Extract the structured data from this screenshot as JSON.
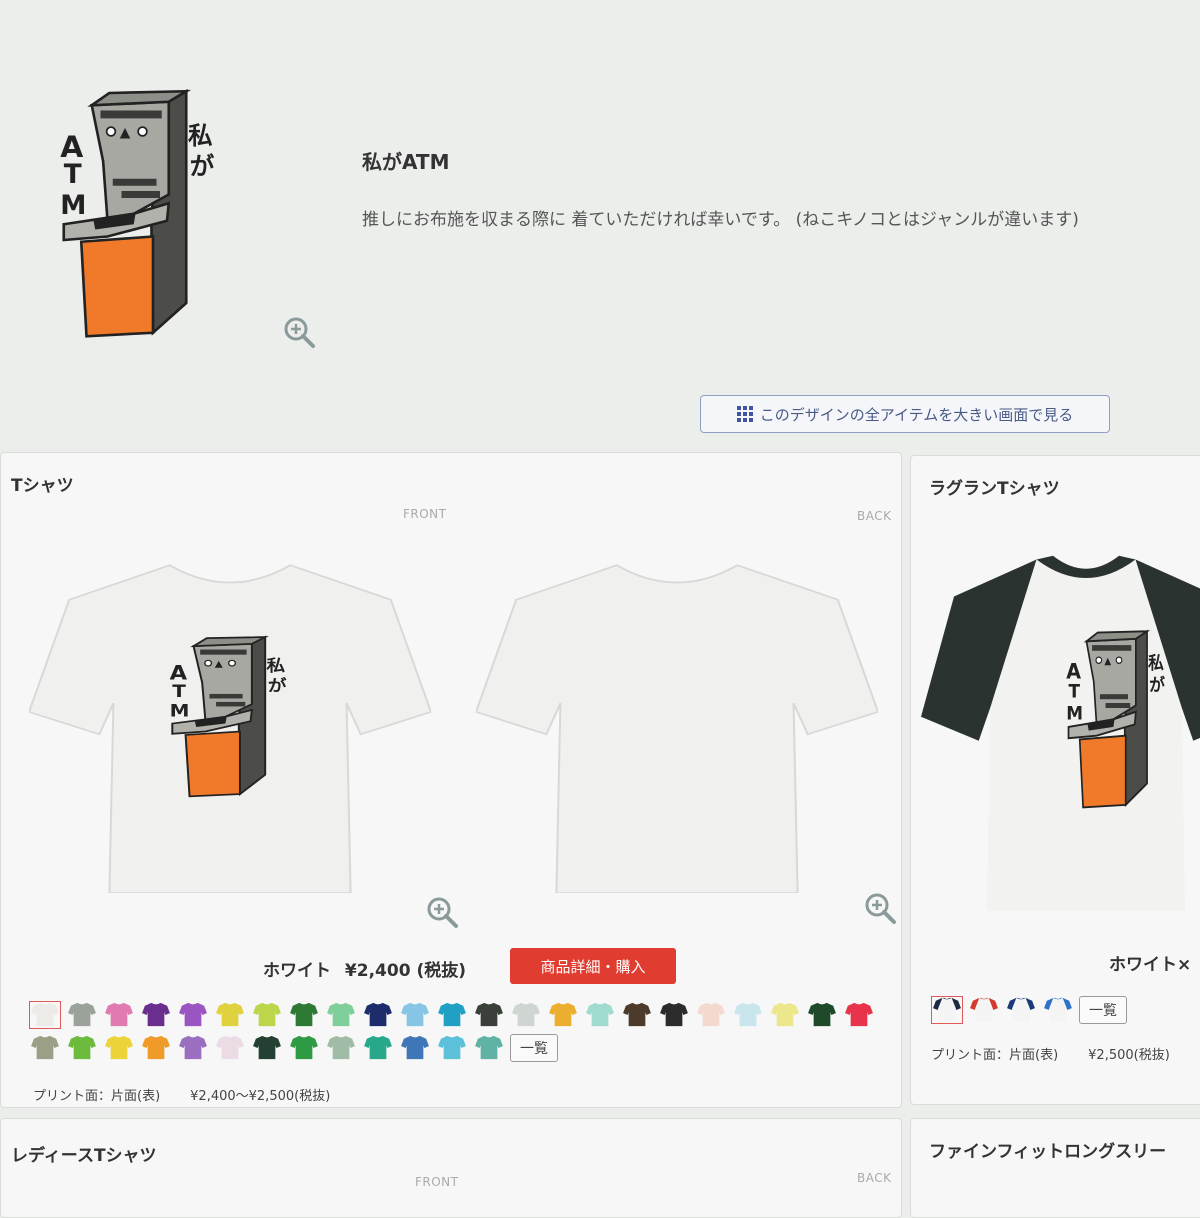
{
  "design": {
    "title": "私がATM",
    "description": "推しにお布施を収まる際に 着ていただければ幸いです。 (ねこキノコとはジャンルが違います)",
    "art_text_vertical": "私が",
    "art_text_side": "ATM",
    "view_all_label": "このデザインの全アイテムを大きい画面で見る"
  },
  "colors": {
    "atm_orange": "#f07a2a",
    "atm_gray": "#a4a69f",
    "buy_red": "#e03c2f",
    "raglan_sleeve": "#2b3330"
  },
  "products": [
    {
      "title": "Tシャツ",
      "front_label": "FRONT",
      "back_label": "BACK",
      "color_name": "ホワイト",
      "price": "¥2,400 (税抜)",
      "buy_label": "商品詳細・購入",
      "list_label": "一覧",
      "print_face": "プリント面：片面(表)",
      "price_range": "¥2,400〜¥2,500(税抜)",
      "swatches": [
        "#ecebe8",
        "#9aa29a",
        "#e07ab0",
        "#6a2f8e",
        "#9a55c2",
        "#e0d23e",
        "#bcd64c",
        "#2e7a34",
        "#7fcf9a",
        "#1d2d6b",
        "#86c6e4",
        "#22a0c4",
        "#3a3f3a",
        "#cfd6d2",
        "#ecae2e",
        "#9fdccf",
        "#4c3a2c",
        "#2c2c2c",
        "#f3d9d0",
        "#c9e6ee",
        "#ece78a",
        "#1f4a2a",
        "#e8344a",
        "#9a9f85",
        "#6cbb3c",
        "#ecd33a",
        "#f09a2a",
        "#9a6fc0",
        "#eadbe4",
        "#234032",
        "#2e9a44",
        "#a0bca6",
        "#27a88a",
        "#3f76b8",
        "#5cc0d8",
        "#5fb2a4"
      ]
    },
    {
      "title": "ラグランTシャツ",
      "color_name": "ホワイト×",
      "list_label": "一覧",
      "print_face": "プリント面：片面(表)",
      "price": "¥2,500(税抜)",
      "swatches": [
        "#1d2a44",
        "#d33b2e",
        "#1a3a78",
        "#2f72c8"
      ]
    },
    {
      "title": "レディースTシャツ",
      "front_label": "FRONT",
      "back_label": "BACK"
    },
    {
      "title": "ファインフィットロングスリー"
    }
  ]
}
